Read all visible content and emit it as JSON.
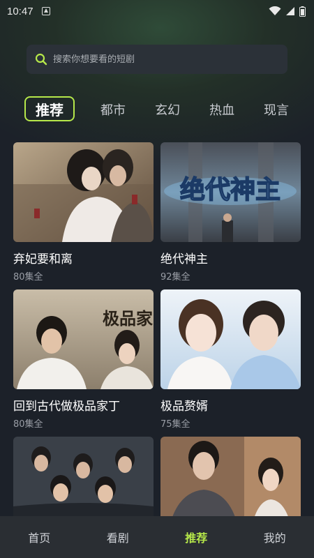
{
  "status": {
    "time": "10:47"
  },
  "search": {
    "placeholder": "搜索你想要看的短剧"
  },
  "tabs": [
    {
      "label": "推荐",
      "active": true
    },
    {
      "label": "都市"
    },
    {
      "label": "玄幻"
    },
    {
      "label": "热血"
    },
    {
      "label": "现言"
    }
  ],
  "dramas": [
    {
      "title": "弃妃要和离",
      "episodes": "80集全"
    },
    {
      "title": "绝代神主",
      "episodes": "92集全",
      "poster_text": "绝代神主"
    },
    {
      "title": "回到古代做极品家丁",
      "episodes": "80集全",
      "poster_text": "极品家丁"
    },
    {
      "title": "极品赘婿",
      "episodes": "75集全"
    },
    {
      "title": "",
      "episodes": ""
    },
    {
      "title": "",
      "episodes": ""
    }
  ],
  "nav": [
    {
      "label": "首页"
    },
    {
      "label": "看剧"
    },
    {
      "label": "推荐",
      "active": true
    },
    {
      "label": "我的"
    }
  ],
  "colors": {
    "accent": "#b6e84a",
    "background": "#1c2129",
    "nav_bg": "#2a2e33"
  }
}
